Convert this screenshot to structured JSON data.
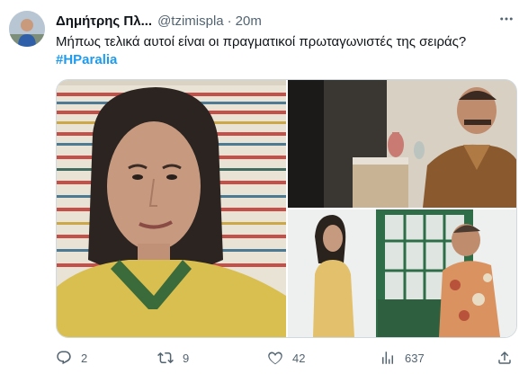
{
  "tweet": {
    "display_name": "Δημήτρης Πλ...",
    "handle": "@tzimispla",
    "separator": "·",
    "time": "20m",
    "text": "Μήπως τελικά αυτοί είναι οι πραγματικοί πρωταγωνιστές της σειράς?",
    "hashtag": "#HParalia"
  },
  "actions": {
    "reply_count": "2",
    "retweet_count": "9",
    "like_count": "42",
    "view_count": "637"
  },
  "colors": {
    "text": "#0f1419",
    "secondary": "#536471",
    "link": "#1d9bf0",
    "border": "#cfd9de"
  },
  "icons": {
    "reply": "reply-icon",
    "retweet": "retweet-icon",
    "like": "heart-icon",
    "views": "views-icon",
    "share": "share-icon",
    "more": "more-icon"
  }
}
